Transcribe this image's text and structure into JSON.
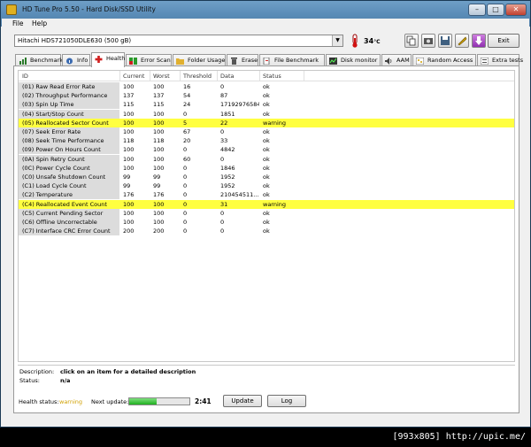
{
  "window": {
    "title": "HD Tune Pro 5.50 - Hard Disk/SSD Utility",
    "minimize": "–",
    "maximize": "□",
    "close": "✕"
  },
  "menu": {
    "file": "File",
    "help": "Help"
  },
  "toolbar": {
    "drive": "Hitachi HDS721050DLE630 (500 gB)",
    "temperature": "34",
    "temperature_unit": "°C",
    "exit_label": "Exit"
  },
  "tabs": [
    {
      "label": "Benchmark",
      "icon": "benchmark-icon"
    },
    {
      "label": "Info",
      "icon": "info-icon"
    },
    {
      "label": "Health",
      "icon": "health-cross-icon"
    },
    {
      "label": "Error Scan",
      "icon": "error-scan-icon"
    },
    {
      "label": "Folder Usage",
      "icon": "folder-icon"
    },
    {
      "label": "Erase",
      "icon": "trash-icon"
    },
    {
      "label": "File Benchmark",
      "icon": "file-benchmark-icon"
    },
    {
      "label": "Disk monitor",
      "icon": "disk-monitor-icon"
    },
    {
      "label": "AAM",
      "icon": "speaker-icon"
    },
    {
      "label": "Random Access",
      "icon": "random-access-icon"
    },
    {
      "label": "Extra tests",
      "icon": "extra-tests-icon"
    }
  ],
  "health": {
    "columns": [
      "ID",
      "Current",
      "Worst",
      "Threshold",
      "Data",
      "Status"
    ],
    "rows": [
      {
        "id": "(01) Raw Read Error Rate",
        "current": "100",
        "worst": "100",
        "threshold": "16",
        "data": "0",
        "status": "ok",
        "warn": false
      },
      {
        "id": "(02) Throughput Performance",
        "current": "137",
        "worst": "137",
        "threshold": "54",
        "data": "87",
        "status": "ok",
        "warn": false
      },
      {
        "id": "(03) Spin Up Time",
        "current": "115",
        "worst": "115",
        "threshold": "24",
        "data": "17192976584",
        "status": "ok",
        "warn": false
      },
      {
        "id": "(04) Start/Stop Count",
        "current": "100",
        "worst": "100",
        "threshold": "0",
        "data": "1851",
        "status": "ok",
        "warn": false
      },
      {
        "id": "(05) Reallocated Sector Count",
        "current": "100",
        "worst": "100",
        "threshold": "5",
        "data": "22",
        "status": "warning",
        "warn": true
      },
      {
        "id": "(07) Seek Error Rate",
        "current": "100",
        "worst": "100",
        "threshold": "67",
        "data": "0",
        "status": "ok",
        "warn": false
      },
      {
        "id": "(08) Seek Time Performance",
        "current": "118",
        "worst": "118",
        "threshold": "20",
        "data": "33",
        "status": "ok",
        "warn": false
      },
      {
        "id": "(09) Power On Hours Count",
        "current": "100",
        "worst": "100",
        "threshold": "0",
        "data": "4842",
        "status": "ok",
        "warn": false
      },
      {
        "id": "(0A) Spin Retry Count",
        "current": "100",
        "worst": "100",
        "threshold": "60",
        "data": "0",
        "status": "ok",
        "warn": false
      },
      {
        "id": "(0C) Power Cycle Count",
        "current": "100",
        "worst": "100",
        "threshold": "0",
        "data": "1846",
        "status": "ok",
        "warn": false
      },
      {
        "id": "(C0) Unsafe Shutdown Count",
        "current": "99",
        "worst": "99",
        "threshold": "0",
        "data": "1952",
        "status": "ok",
        "warn": false
      },
      {
        "id": "(C1) Load Cycle Count",
        "current": "99",
        "worst": "99",
        "threshold": "0",
        "data": "1952",
        "status": "ok",
        "warn": false
      },
      {
        "id": "(C2) Temperature",
        "current": "176",
        "worst": "176",
        "threshold": "0",
        "data": "210454511...",
        "status": "ok",
        "warn": false
      },
      {
        "id": "(C4) Reallocated Event Count",
        "current": "100",
        "worst": "100",
        "threshold": "0",
        "data": "31",
        "status": "warning",
        "warn": true
      },
      {
        "id": "(C5) Current Pending Sector",
        "current": "100",
        "worst": "100",
        "threshold": "0",
        "data": "0",
        "status": "ok",
        "warn": false
      },
      {
        "id": "(C6) Offline Uncorrectable",
        "current": "100",
        "worst": "100",
        "threshold": "0",
        "data": "0",
        "status": "ok",
        "warn": false
      },
      {
        "id": "(C7) Interface CRC Error Count",
        "current": "200",
        "worst": "200",
        "threshold": "0",
        "data": "0",
        "status": "ok",
        "warn": false
      }
    ]
  },
  "description": {
    "desc_label": "Description:",
    "desc_value": "click on an item for a detailed description",
    "status_label": "Status:",
    "status_value": "n/a"
  },
  "footer": {
    "health_status_label": "Health status:",
    "health_status_value": "warning",
    "next_update_label": "Next update:",
    "progress_fraction": 0.45,
    "time_left": "2:41",
    "update_label": "Update",
    "log_label": "Log"
  },
  "watermark": "[993x805] http://upic.me/"
}
